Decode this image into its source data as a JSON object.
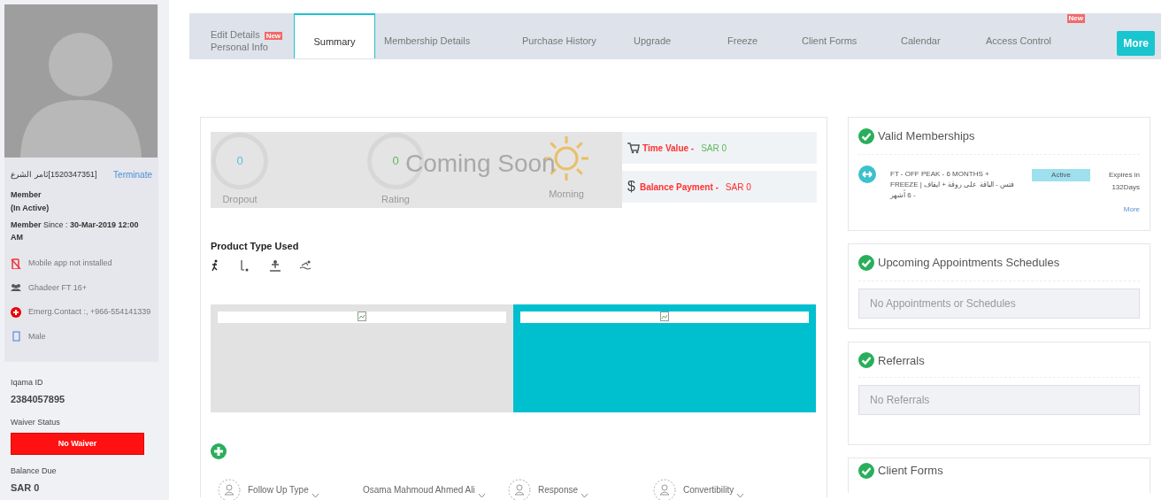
{
  "profile": {
    "name": "ثامر الشرع",
    "member_id": "[1520347351]",
    "terminate": "Terminate",
    "role": "Member",
    "state": "(In Active)",
    "since": "**Member** Since : **30-Mar-2019 12:00 AM**",
    "details": [
      {
        "kind": "mobile-off",
        "text": "Mobile app not installed"
      },
      {
        "kind": "group",
        "text": "Ghadeer FT 16+"
      },
      {
        "kind": "emergency",
        "text": "Emerg.Contact :, +966-554141339"
      },
      {
        "kind": "gender",
        "text": "Male"
      }
    ]
  },
  "sidebar_fields": [
    {
      "label": "Iqama ID",
      "value": "2384057895",
      "kind": "text"
    },
    {
      "label": "Waiver Status",
      "value": "No Waiver",
      "kind": "alert"
    },
    {
      "label": "Balance Due",
      "value": "SAR 0",
      "kind": "text"
    }
  ],
  "tabs": [
    {
      "label": "Edit Details",
      "badge": "New",
      "sublabel": "Personal Info",
      "selected": false
    },
    {
      "label": "Summary",
      "selected": true
    },
    {
      "label": "Membership Details",
      "selected": false
    },
    {
      "label": "Purchase History",
      "selected": false
    },
    {
      "label": "Upgrade",
      "selected": false
    },
    {
      "label": "Freeze",
      "selected": false
    },
    {
      "label": "Client Forms",
      "selected": false
    },
    {
      "label": "Calendar",
      "selected": false
    },
    {
      "label": "Access Control",
      "badge": "New",
      "selected": false
    }
  ],
  "more_button": "More",
  "stats": {
    "overlay": "Coming Soon",
    "items": [
      {
        "kind": "ring",
        "value": "0",
        "label": "Dropout",
        "color": "#5bc0de"
      },
      {
        "kind": "ring",
        "value": "0",
        "label": "Rating",
        "color": "#5cb85c"
      },
      {
        "kind": "sun",
        "label": "Morning"
      }
    ]
  },
  "values": [
    {
      "kind": "cart",
      "label": "Time Value -",
      "value": "SAR 0",
      "color": "#5cb85c"
    },
    {
      "kind": "dollar",
      "symbol": "$",
      "label": "Balance Payment -",
      "value": "SAR 0",
      "color": "#ff2a2a"
    }
  ],
  "product_type": {
    "title": "Product Type Used"
  },
  "banners": [
    {
      "color": "#e2e2e2"
    },
    {
      "color": "#00bfcf"
    }
  ],
  "follow_up": [
    {
      "kind": "person",
      "label": "Follow Up Type"
    },
    {
      "kind": "plain",
      "label": "Osama Mahmoud Ahmed Ali"
    },
    {
      "kind": "person",
      "label": "Response"
    },
    {
      "kind": "person",
      "label": "Convertibility"
    }
  ],
  "cards": [
    {
      "title": "Valid Memberships",
      "kind": "memberships",
      "items": [
        {
          "name": "FT - OFF PEAK - 6 MONTHS + FREEZE | فتس - الباقة على روقة + ايقاف - 6 أشهر",
          "status": "Active",
          "expires": "Expires in",
          "days": "132Days"
        }
      ],
      "link": "More"
    },
    {
      "title": "Upcoming Appointments Schedules",
      "kind": "empty",
      "message": "No Appointments or Schedules"
    },
    {
      "title": "Referrals",
      "kind": "empty",
      "message": "No Referrals"
    },
    {
      "title": "Client Forms",
      "kind": "title"
    }
  ]
}
